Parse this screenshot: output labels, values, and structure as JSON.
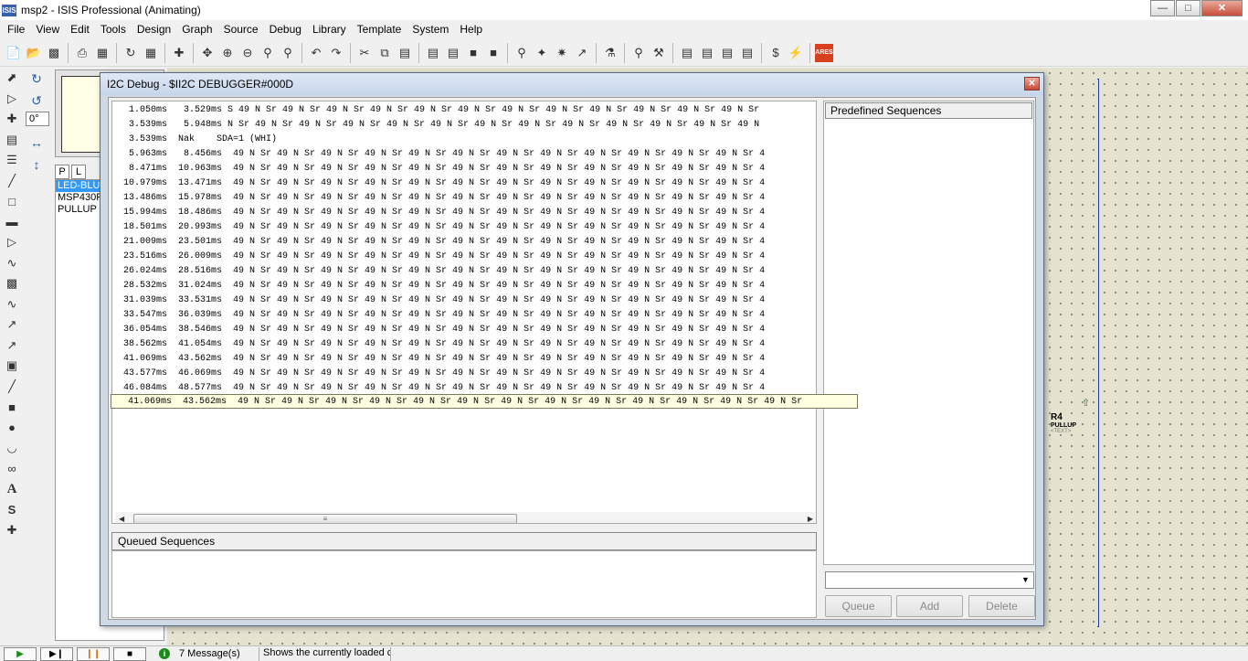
{
  "window": {
    "title": "msp2 - ISIS Professional (Animating)",
    "app_icon": "ISIS"
  },
  "menu": [
    "File",
    "View",
    "Edit",
    "Tools",
    "Design",
    "Graph",
    "Source",
    "Debug",
    "Library",
    "Template",
    "System",
    "Help"
  ],
  "side_panel": {
    "tabs": [
      "P",
      "L"
    ],
    "devices": [
      "LED-BLU",
      "MSP430F",
      "PULLUP"
    ],
    "angle": "0°"
  },
  "canvas": {
    "r4_label": "R4",
    "r4_type": "PULLUP",
    "r4_text": "<TEXT>"
  },
  "dialog": {
    "title": "I2C Debug - $II2C DEBUGGER#000D",
    "log": [
      "1.050ms   3.529ms S 49 N Sr 49 N Sr 49 N Sr 49 N Sr 49 N Sr 49 N Sr 49 N Sr 49 N Sr 49 N Sr 49 N Sr 49 N Sr 49 N Sr",
      "3.539ms   5.948ms N Sr 49 N Sr 49 N Sr 49 N Sr 49 N Sr 49 N Sr 49 N Sr 49 N Sr 49 N Sr 49 N Sr 49 N Sr 49 N Sr 49 N",
      "3.539ms  Nak    SDA=1 (WHI)",
      "5.963ms   8.456ms  49 N Sr 49 N Sr 49 N Sr 49 N Sr 49 N Sr 49 N Sr 49 N Sr 49 N Sr 49 N Sr 49 N Sr 49 N Sr 49 N Sr 4",
      "8.471ms  10.963ms  49 N Sr 49 N Sr 49 N Sr 49 N Sr 49 N Sr 49 N Sr 49 N Sr 49 N Sr 49 N Sr 49 N Sr 49 N Sr 49 N Sr 4",
      "10.979ms  13.471ms  49 N Sr 49 N Sr 49 N Sr 49 N Sr 49 N Sr 49 N Sr 49 N Sr 49 N Sr 49 N Sr 49 N Sr 49 N Sr 49 N Sr 4",
      "13.486ms  15.978ms  49 N Sr 49 N Sr 49 N Sr 49 N Sr 49 N Sr 49 N Sr 49 N Sr 49 N Sr 49 N Sr 49 N Sr 49 N Sr 49 N Sr 4",
      "15.994ms  18.486ms  49 N Sr 49 N Sr 49 N Sr 49 N Sr 49 N Sr 49 N Sr 49 N Sr 49 N Sr 49 N Sr 49 N Sr 49 N Sr 49 N Sr 4",
      "18.501ms  20.993ms  49 N Sr 49 N Sr 49 N Sr 49 N Sr 49 N Sr 49 N Sr 49 N Sr 49 N Sr 49 N Sr 49 N Sr 49 N Sr 49 N Sr 4",
      "21.009ms  23.501ms  49 N Sr 49 N Sr 49 N Sr 49 N Sr 49 N Sr 49 N Sr 49 N Sr 49 N Sr 49 N Sr 49 N Sr 49 N Sr 49 N Sr 4",
      "23.516ms  26.009ms  49 N Sr 49 N Sr 49 N Sr 49 N Sr 49 N Sr 49 N Sr 49 N Sr 49 N Sr 49 N Sr 49 N Sr 49 N Sr 49 N Sr 4",
      "26.024ms  28.516ms  49 N Sr 49 N Sr 49 N Sr 49 N Sr 49 N Sr 49 N Sr 49 N Sr 49 N Sr 49 N Sr 49 N Sr 49 N Sr 49 N Sr 4",
      "28.532ms  31.024ms  49 N Sr 49 N Sr 49 N Sr 49 N Sr 49 N Sr 49 N Sr 49 N Sr 49 N Sr 49 N Sr 49 N Sr 49 N Sr 49 N Sr 4",
      "31.039ms  33.531ms  49 N Sr 49 N Sr 49 N Sr 49 N Sr 49 N Sr 49 N Sr 49 N Sr 49 N Sr 49 N Sr 49 N Sr 49 N Sr 49 N Sr 4",
      "33.547ms  36.039ms  49 N Sr 49 N Sr 49 N Sr 49 N Sr 49 N Sr 49 N Sr 49 N Sr 49 N Sr 49 N Sr 49 N Sr 49 N Sr 49 N Sr 4",
      "36.054ms  38.546ms  49 N Sr 49 N Sr 49 N Sr 49 N Sr 49 N Sr 49 N Sr 49 N Sr 49 N Sr 49 N Sr 49 N Sr 49 N Sr 49 N Sr 4",
      "38.562ms  41.054ms  49 N Sr 49 N Sr 49 N Sr 49 N Sr 49 N Sr 49 N Sr 49 N Sr 49 N Sr 49 N Sr 49 N Sr 49 N Sr 49 N Sr 4",
      "41.069ms  43.562ms  49 N Sr 49 N Sr 49 N Sr 49 N Sr 49 N Sr 49 N Sr 49 N Sr 49 N Sr 49 N Sr 49 N Sr 49 N Sr 49 N Sr 4",
      "43.577ms  46.069ms  49 N Sr 49 N Sr 49 N Sr 49 N Sr 49 N Sr 49 N Sr 49 N Sr 49 N Sr 49 N Sr 49 N Sr 49 N Sr 49 N Sr 4",
      "46.084ms  48.577ms  49 N Sr 49 N Sr 49 N Sr 49 N Sr 49 N Sr 49 N Sr 49 N Sr 49 N Sr 49 N Sr 49 N Sr 49 N Sr 49 N Sr 4"
    ],
    "tooltip_row": "41.069ms  43.562ms  49 N Sr 49 N Sr 49 N Sr 49 N Sr 49 N Sr 49 N Sr 49 N Sr 49 N Sr 49 N Sr 49 N Sr 49 N Sr 49 N Sr 49 N Sr",
    "queued_label": "Queued Sequences",
    "predefined_label": "Predefined Sequences",
    "buttons": {
      "queue": "Queue",
      "add": "Add",
      "delete": "Delete"
    }
  },
  "status": {
    "messages": "7 Message(s)",
    "hint": "Shows the currently loaded c"
  }
}
